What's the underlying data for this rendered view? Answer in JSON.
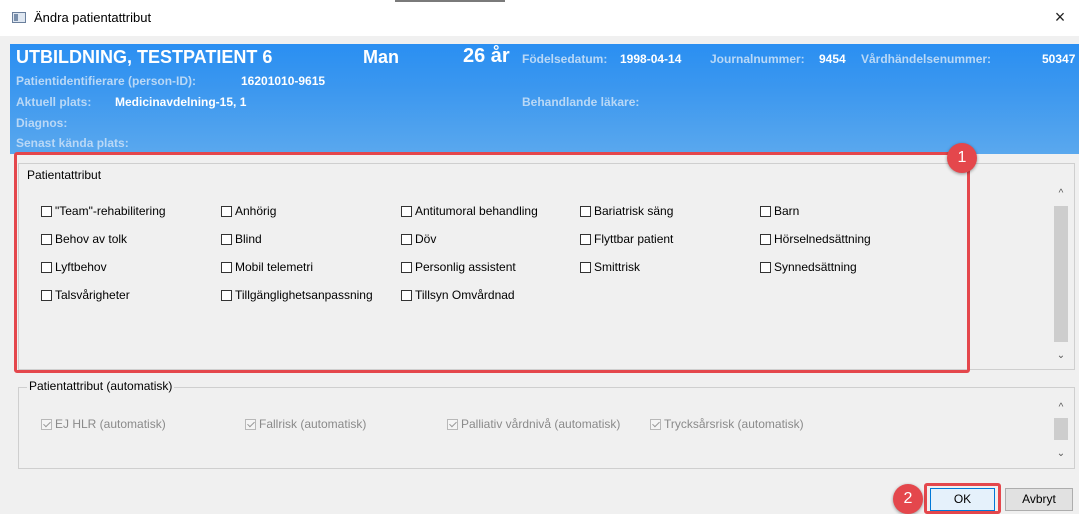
{
  "window": {
    "title": "Ändra patientattribut",
    "close": "×"
  },
  "header": {
    "name": "UTBILDNING, TESTPATIENT 6",
    "sex": "Man",
    "age": "26 år",
    "birthdate_label": "Födelsedatum:",
    "birthdate": "1998-04-14",
    "journal_label": "Journalnummer:",
    "journal": "9454",
    "event_label": "Vårdhändelsenummer:",
    "event": "50347",
    "id_label": "Patientidentifierare (person-ID):",
    "id": "16201010-9615",
    "location_label": "Aktuell plats:",
    "location": "Medicinavdelning-15, 1",
    "doctor_label": "Behandlande läkare:",
    "diagnosis_label": "Diagnos:",
    "last_place_label": "Senast kända plats:"
  },
  "attributes": {
    "legend": "Patientattribut",
    "items": [
      "\"Team\"-rehabilitering",
      "Anhörig",
      "Antitumoral behandling",
      "Bariatrisk säng",
      "Barn",
      "Behov av tolk",
      "Blind",
      "Döv",
      "Flyttbar patient",
      "Hörselnedsättning",
      "Lyftbehov",
      "Mobil telemetri",
      "Personlig assistent",
      "Smittrisk",
      "Synnedsättning",
      "Talsvårigheter",
      "Tillgänglighetsanpassning",
      "Tillsyn Omvårdnad"
    ]
  },
  "auto_attributes": {
    "legend": "Patientattribut (automatisk)",
    "items": [
      "EJ HLR (automatisk)",
      "Fallrisk (automatisk)",
      "Palliativ vårdnivå (automatisk)",
      "Trycksårsrisk (automatisk)"
    ]
  },
  "scroll": {
    "up": "^",
    "down": "⌄"
  },
  "buttons": {
    "ok": "OK",
    "cancel": "Avbryt"
  },
  "markers": {
    "one": "1",
    "two": "2"
  },
  "colors": {
    "header_blue": "#2a8ff2",
    "highlight_red": "#e4474c"
  }
}
